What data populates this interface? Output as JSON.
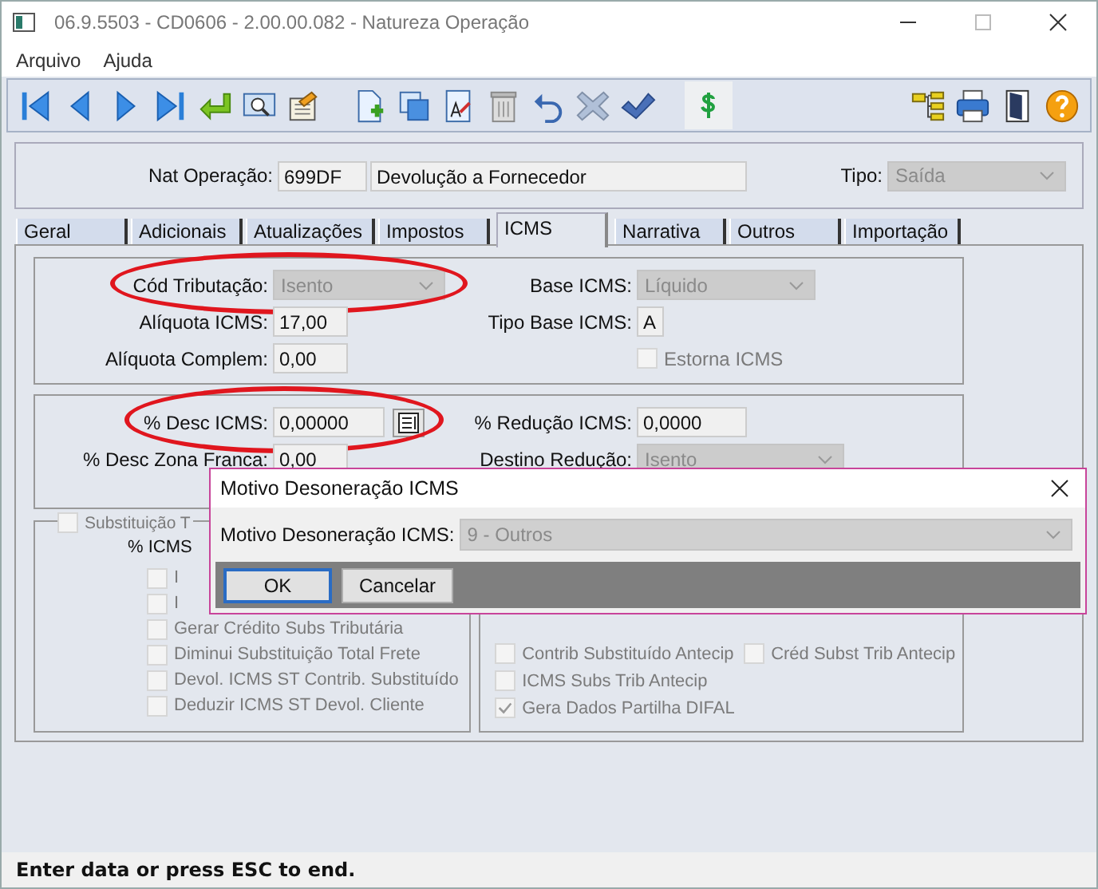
{
  "window": {
    "title": "06.9.5503 - CD0606 - 2.00.00.082 - Natureza Operação"
  },
  "menu": [
    "Arquivo",
    "Ajuda"
  ],
  "header": {
    "label": "Nat Operação:",
    "code": "699DF",
    "description": "Devolução a Fornecedor",
    "tipo_label": "Tipo:",
    "tipo": "Saída"
  },
  "tabs": [
    {
      "label": "Geral",
      "selected": false
    },
    {
      "label": "Adicionais",
      "selected": false
    },
    {
      "label": "Atualizações",
      "selected": false
    },
    {
      "label": "Impostos",
      "selected": false
    },
    {
      "label": "ICMS",
      "selected": true
    },
    {
      "label": "Narrativa",
      "selected": false
    },
    {
      "label": "Outros",
      "selected": false
    },
    {
      "label": "Importação",
      "selected": false
    }
  ],
  "groups": [
    {
      "rows": [
        [
          {
            "label": "Cód Tributação:",
            "value": "Isento",
            "kind": "select",
            "annotated": true
          },
          {
            "label": "Base ICMS:",
            "value": "Líquido",
            "kind": "select"
          }
        ]
      ],
      "more": [
        [
          {
            "label": "Alíquota ICMS:",
            "value": "17,00",
            "kind": "input"
          },
          {
            "label": "Tipo Base ICMS:",
            "value": "A",
            "kind": "input"
          }
        ],
        [
          {
            "label": "Alíquota Complem:",
            "value": "0,00",
            "kind": "input"
          },
          {
            "label": "Estorna ICMS",
            "kind": "checkbox",
            "checked": false,
            "disabled": true
          }
        ]
      ]
    },
    {
      "rows": [
        [
          {
            "label": "% Desc ICMS:",
            "value": "0,00000",
            "kind": "input_button",
            "annotated": true
          },
          {
            "label": "% Redução ICMS:",
            "value": "0,0000",
            "kind": "input"
          }
        ],
        [
          {
            "label": "% Desc Zona Franca:",
            "value": "0,00",
            "kind": "input"
          },
          {
            "label": "Destino Redução:",
            "value": "Isento",
            "kind": "select"
          }
        ]
      ]
    }
  ],
  "substitution": {
    "title": {
      "label": "Substituição T",
      "checked": false,
      "disabled": true
    },
    "icms_label": "% ICMS",
    "options": [
      {
        "label": "I",
        "checked": false,
        "disabled": true
      },
      {
        "label": "I",
        "checked": false,
        "disabled": true
      },
      {
        "label": "Gerar Crédito Subs Tributária",
        "checked": false,
        "disabled": true
      },
      {
        "label": "Diminui Substituição Total Frete",
        "checked": false,
        "disabled": true
      },
      {
        "label": "Devol. ICMS ST Contrib. Substituído",
        "checked": false,
        "disabled": true
      },
      {
        "label": "Deduzir ICMS ST Devol. Cliente",
        "checked": false,
        "disabled": true
      }
    ]
  },
  "antecip": {
    "rows": [
      [
        {
          "label": "Contrib Substituído Antecip",
          "checked": false,
          "disabled": true
        },
        {
          "label": "Créd Subst Trib Antecip",
          "checked": false,
          "disabled": true
        }
      ],
      [
        {
          "label": "ICMS Subs Trib Antecip",
          "checked": false,
          "disabled": true
        }
      ],
      [
        {
          "label": "Gera Dados Partilha DIFAL",
          "checked": true,
          "disabled": true
        }
      ]
    ]
  },
  "dialog": {
    "title": "Motivo Desoneração ICMS",
    "label": "Motivo Desoneração ICMS:",
    "value": "9 - Outros",
    "buttons": [
      {
        "label": "OK",
        "default": true
      },
      {
        "label": "Cancelar",
        "default": false
      }
    ]
  },
  "status_bar": "Enter data or press ESC to end."
}
